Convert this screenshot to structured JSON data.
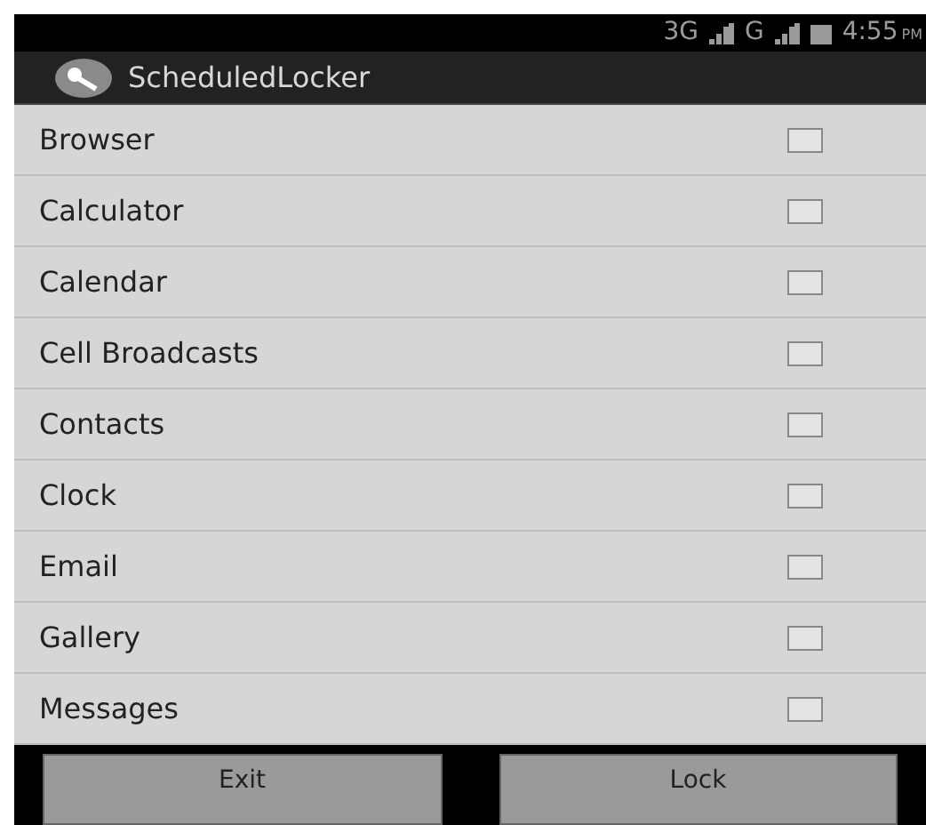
{
  "status_bar": {
    "network_1": "3G",
    "network_2": "G",
    "time": "4:55",
    "time_suffix": "PM"
  },
  "action_bar": {
    "title": "ScheduledLocker"
  },
  "apps": [
    {
      "label": "Browser",
      "checked": false
    },
    {
      "label": "Calculator",
      "checked": false
    },
    {
      "label": "Calendar",
      "checked": false
    },
    {
      "label": "Cell Broadcasts",
      "checked": false
    },
    {
      "label": "Contacts",
      "checked": false
    },
    {
      "label": "Clock",
      "checked": false
    },
    {
      "label": "Email",
      "checked": false
    },
    {
      "label": "Gallery",
      "checked": false
    },
    {
      "label": "Messages",
      "checked": false
    }
  ],
  "buttons": [
    {
      "label": "Exit"
    },
    {
      "label": "Lock"
    }
  ]
}
